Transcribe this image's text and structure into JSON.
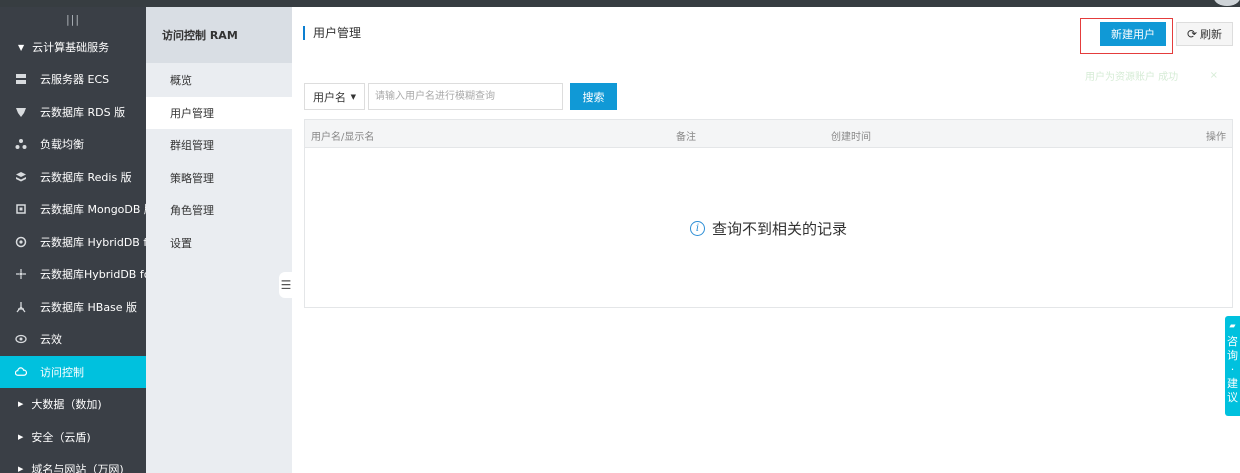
{
  "sidebar": {
    "collapse_icon": "menu-collapse-icon",
    "group_label": "云计算基础服务",
    "items": [
      {
        "label": "云服务器 ECS",
        "icon": "server-icon"
      },
      {
        "label": "云数据库 RDS 版",
        "icon": "database-icon"
      },
      {
        "label": "负载均衡",
        "icon": "load-balancer-icon"
      },
      {
        "label": "云数据库 Redis 版",
        "icon": "redis-icon"
      },
      {
        "label": "云数据库 MongoDB 版",
        "icon": "mongodb-icon"
      },
      {
        "label": "云数据库 HybridDB fo...",
        "icon": "hybriddb-icon"
      },
      {
        "label": "云数据库HybridDB for...",
        "icon": "hybriddb2-icon"
      },
      {
        "label": "云数据库 HBase 版",
        "icon": "hbase-icon"
      },
      {
        "label": "云效",
        "icon": "devops-icon"
      },
      {
        "label": "访问控制",
        "icon": "cloud-icon"
      }
    ],
    "sub_groups": [
      "大数据（数加)",
      "安全（云盾)",
      "域名与网站（万网)"
    ]
  },
  "subnav": {
    "title": "访问控制 RAM",
    "items": [
      "概览",
      "用户管理",
      "群组管理",
      "策略管理",
      "角色管理",
      "设置"
    ]
  },
  "header": {
    "page_title": "用户管理",
    "new_user_label": "新建用户",
    "refresh_label": "刷新",
    "toast_text": "用户为资源账户 成功"
  },
  "search": {
    "filter_value": "用户名",
    "placeholder": "请输入用户名进行模糊查询",
    "button_label": "搜索"
  },
  "table": {
    "columns": [
      "用户名/显示名",
      "备注",
      "创建时间",
      "操作"
    ],
    "empty_text": "查询不到相关的记录"
  },
  "feedback": {
    "label_chars": [
      "咨",
      "询",
      "·",
      "建",
      "议"
    ]
  },
  "colors": {
    "accent": "#00c1de",
    "primary_button": "#1099d6",
    "sidebar_bg": "#3a3f46",
    "highlight_border": "#e43c3c"
  }
}
